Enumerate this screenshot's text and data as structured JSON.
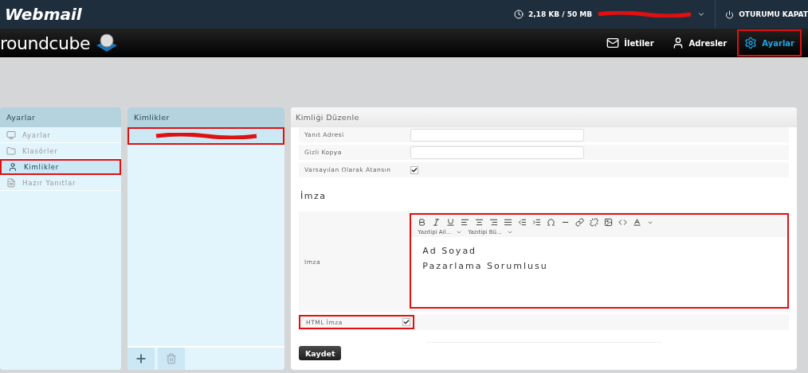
{
  "header": {
    "logo": "Webmail",
    "quota": "2,18 KB / 50 MB",
    "logout": "OTURUMU KAPAT"
  },
  "brand": {
    "name": "roundcube"
  },
  "nav": [
    {
      "kind": "mail",
      "label": "İletiler",
      "selected": false,
      "highlighted": false
    },
    {
      "kind": "contacts",
      "label": "Adresler",
      "selected": false,
      "highlighted": false
    },
    {
      "kind": "settings",
      "label": "Ayarlar",
      "selected": true,
      "highlighted": true
    }
  ],
  "sections": {
    "title": "Ayarlar",
    "items": [
      {
        "kind": "preferences",
        "label": "Ayarlar",
        "selected": false,
        "highlighted": false
      },
      {
        "kind": "folders",
        "label": "Klasörler",
        "selected": false,
        "highlighted": false
      },
      {
        "kind": "identities",
        "label": "Kimlikler",
        "selected": true,
        "highlighted": true
      },
      {
        "kind": "responses",
        "label": "Hazır Yanıtlar",
        "selected": false,
        "highlighted": false
      }
    ]
  },
  "identities": {
    "title": "Kimlikler",
    "items": [
      {
        "selected": true,
        "highlighted": true
      }
    ]
  },
  "form": {
    "title": "Kimliği Düzenle",
    "fields": [
      {
        "kind": "text",
        "label": "Yanıt Adresi"
      },
      {
        "kind": "text",
        "label": "Gizli Kopya"
      },
      {
        "kind": "checkbox",
        "label": "Varsayılan Olarak Atansın",
        "checked": true
      }
    ],
    "section_title": "İmza",
    "signature_label": "Imza",
    "editor": {
      "font_family": "Yazıtipi Ail...",
      "font_size": "Yazıtipi Bü...",
      "lines": [
        "Ad Soyad",
        "Pazarlama Sorumlusu"
      ],
      "highlighted": true
    },
    "html_signature": {
      "label": "HTML İmza",
      "checked": true,
      "highlighted": true
    },
    "save": "Kaydet"
  }
}
